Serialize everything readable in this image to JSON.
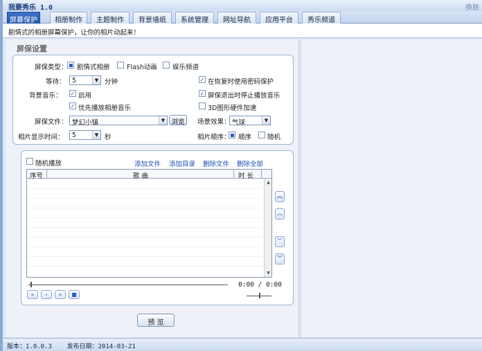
{
  "app": {
    "title": "我要秀乐 1.0",
    "right_label": "换肤"
  },
  "tabs": [
    {
      "label": "屏幕保护",
      "active": true
    },
    {
      "label": "相册制作"
    },
    {
      "label": "主题制作"
    },
    {
      "label": "背景墙纸"
    },
    {
      "label": "系统管理"
    },
    {
      "label": "网址导航"
    },
    {
      "label": "应用平台"
    },
    {
      "label": "秀乐频道"
    }
  ],
  "description": "剧情式的相册屏幕保护，让你的相片动起来！",
  "section_title": "屏保设置",
  "settings": {
    "type_label": "屏保类型：",
    "type_options": [
      "剧情式相册",
      "Flash动画",
      "娱乐频道"
    ],
    "wait_label": "等待：",
    "wait_value": "5",
    "wait_unit": "分钟",
    "password_label": "在恢复时使用密码保护",
    "bgmusic_label": "背景音乐：",
    "enable_label": "启用",
    "stop_music_label": "屏保退出时停止播放音乐",
    "album_music_label": "优先播放相册音乐",
    "hw_accel_label": "3D图形硬件加速",
    "file_label": "屏保文件：",
    "file_value": "梦幻小镇",
    "browse_label": "浏览",
    "scene_label": "场景效果：",
    "scene_value": "气球",
    "photo_time_label": "相片显示时间：",
    "photo_time_value": "5",
    "photo_time_unit": "秒",
    "order_label": "相片顺序：",
    "order_options": [
      "顺序",
      "随机"
    ]
  },
  "playlist": {
    "random_label": "随机播放",
    "actions": [
      "添加文件",
      "添加目录",
      "删除文件",
      "删除全部"
    ],
    "columns": [
      "序号",
      "歌 曲",
      "时 长"
    ],
    "time": "0:00 / 0:00"
  },
  "preview_label": "预 览",
  "status": {
    "version": "版本：1.0.0.3",
    "release": "发布日期：2014-03-21"
  }
}
